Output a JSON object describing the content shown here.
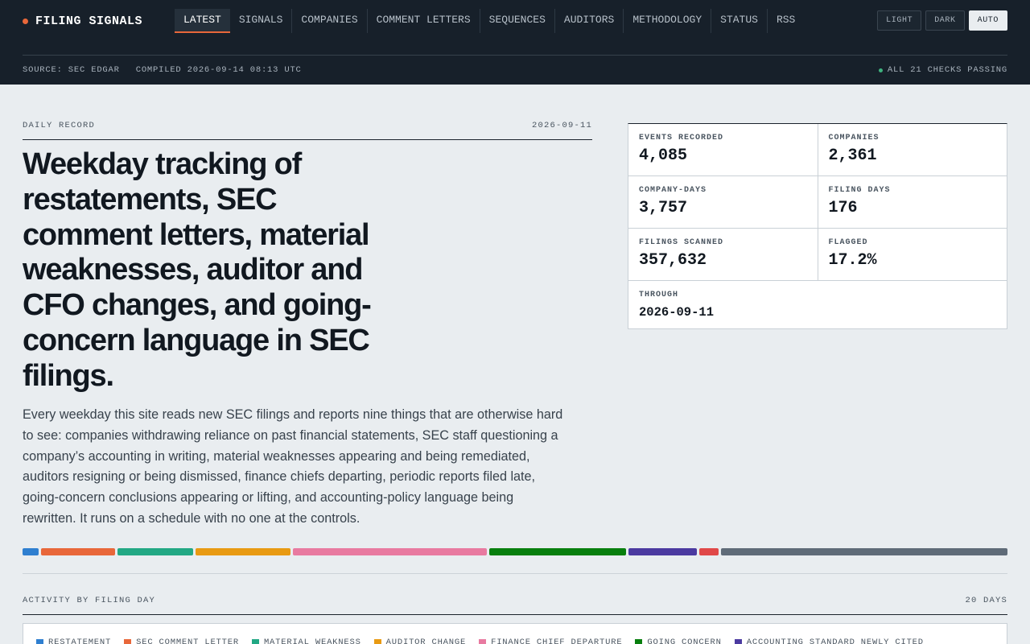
{
  "header": {
    "brand": "FILING SIGNALS",
    "nav": [
      {
        "label": "LATEST",
        "active": true
      },
      {
        "label": "SIGNALS"
      },
      {
        "label": "COMPANIES"
      },
      {
        "label": "COMMENT LETTERS"
      },
      {
        "label": "SEQUENCES"
      },
      {
        "label": "AUDITORS"
      },
      {
        "label": "METHODOLOGY"
      },
      {
        "label": "STATUS"
      },
      {
        "label": "RSS"
      }
    ],
    "theme": {
      "light": "LIGHT",
      "dark": "DARK",
      "auto": "AUTO",
      "selected": "AUTO"
    },
    "source": "SOURCE: SEC EDGAR",
    "compiled": "COMPILED 2026-09-14 08:13 UTC",
    "checks": "ALL 21 CHECKS PASSING"
  },
  "record": {
    "kicker": "DAILY RECORD",
    "date": "2026-09-11",
    "headline": "Weekday tracking of restatements, SEC comment letters, material weaknesses, auditor and CFO changes, and going-concern language in SEC filings.",
    "lede": "Every weekday this site reads new SEC filings and reports nine things that are otherwise hard to see: companies withdrawing reliance on past financial statements, SEC staff questioning a company’s accounting in writing, material weaknesses appearing and being remediated, auditors resigning or being dismissed, finance chiefs departing, periodic reports filed late, going-concern conclusions appearing or lifting, and accounting-policy language being rewritten. It runs on a schedule with no one at the controls."
  },
  "stats": {
    "events_label": "EVENTS RECORDED",
    "events": "4,085",
    "companies_label": "COMPANIES",
    "companies": "2,361",
    "company_days_label": "COMPANY-DAYS",
    "company_days": "3,757",
    "filing_days_label": "FILING DAYS",
    "filing_days": "176",
    "scanned_label": "FILINGS SCANNED",
    "scanned": "357,632",
    "flagged_label": "FLAGGED",
    "flagged": "17.2%",
    "through_label": "THROUGH",
    "through": "2026-09-11"
  },
  "strip": [
    {
      "color": "#2f7fd0",
      "share": 20
    },
    {
      "color": "#e8673a",
      "share": 92
    },
    {
      "color": "#22a884",
      "share": 94
    },
    {
      "color": "#e89a13",
      "share": 118
    },
    {
      "color": "#e87aa0",
      "share": 241
    },
    {
      "color": "#087f0e",
      "share": 171
    },
    {
      "color": "#4b3aa0",
      "share": 85
    },
    {
      "color": "#e04848",
      "share": 24
    },
    {
      "color": "#5f6b78",
      "share": 356
    }
  ],
  "activity": {
    "title": "ACTIVITY BY FILING DAY",
    "range": "20 DAYS",
    "legend": [
      {
        "label": "RESTATEMENT",
        "color": "#2f7fd0"
      },
      {
        "label": "SEC COMMENT LETTER",
        "color": "#e8673a"
      },
      {
        "label": "MATERIAL WEAKNESS",
        "color": "#22a884"
      },
      {
        "label": "AUDITOR CHANGE",
        "color": "#e89a13"
      },
      {
        "label": "FINANCE CHIEF DEPARTURE",
        "color": "#e87aa0"
      },
      {
        "label": "GOING CONCERN",
        "color": "#087f0e"
      },
      {
        "label": "ACCOUNTING STANDARD NEWLY CITED",
        "color": "#4b3aa0"
      }
    ]
  }
}
